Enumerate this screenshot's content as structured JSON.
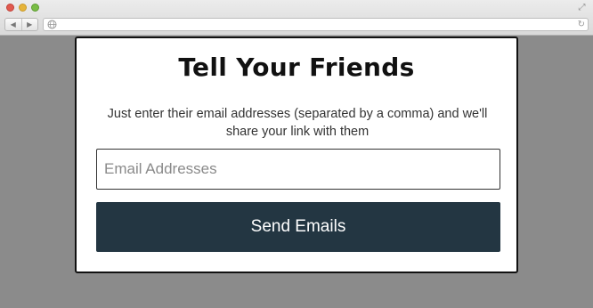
{
  "browser": {
    "url": "",
    "back_glyph": "◀",
    "forward_glyph": "▶",
    "globe_glyph": "🌐",
    "reload_glyph": "↻",
    "expand_glyph": "⤢"
  },
  "modal": {
    "title": "Tell Your Friends",
    "description": "Just enter their email addresses (separated by a comma) and we'll share your link with them",
    "email_placeholder": "Email Addresses",
    "email_value": "",
    "send_label": "Send Emails"
  },
  "colors": {
    "overlay": "#8b8b8b",
    "button_bg": "#233642",
    "button_text": "#ffffff"
  }
}
